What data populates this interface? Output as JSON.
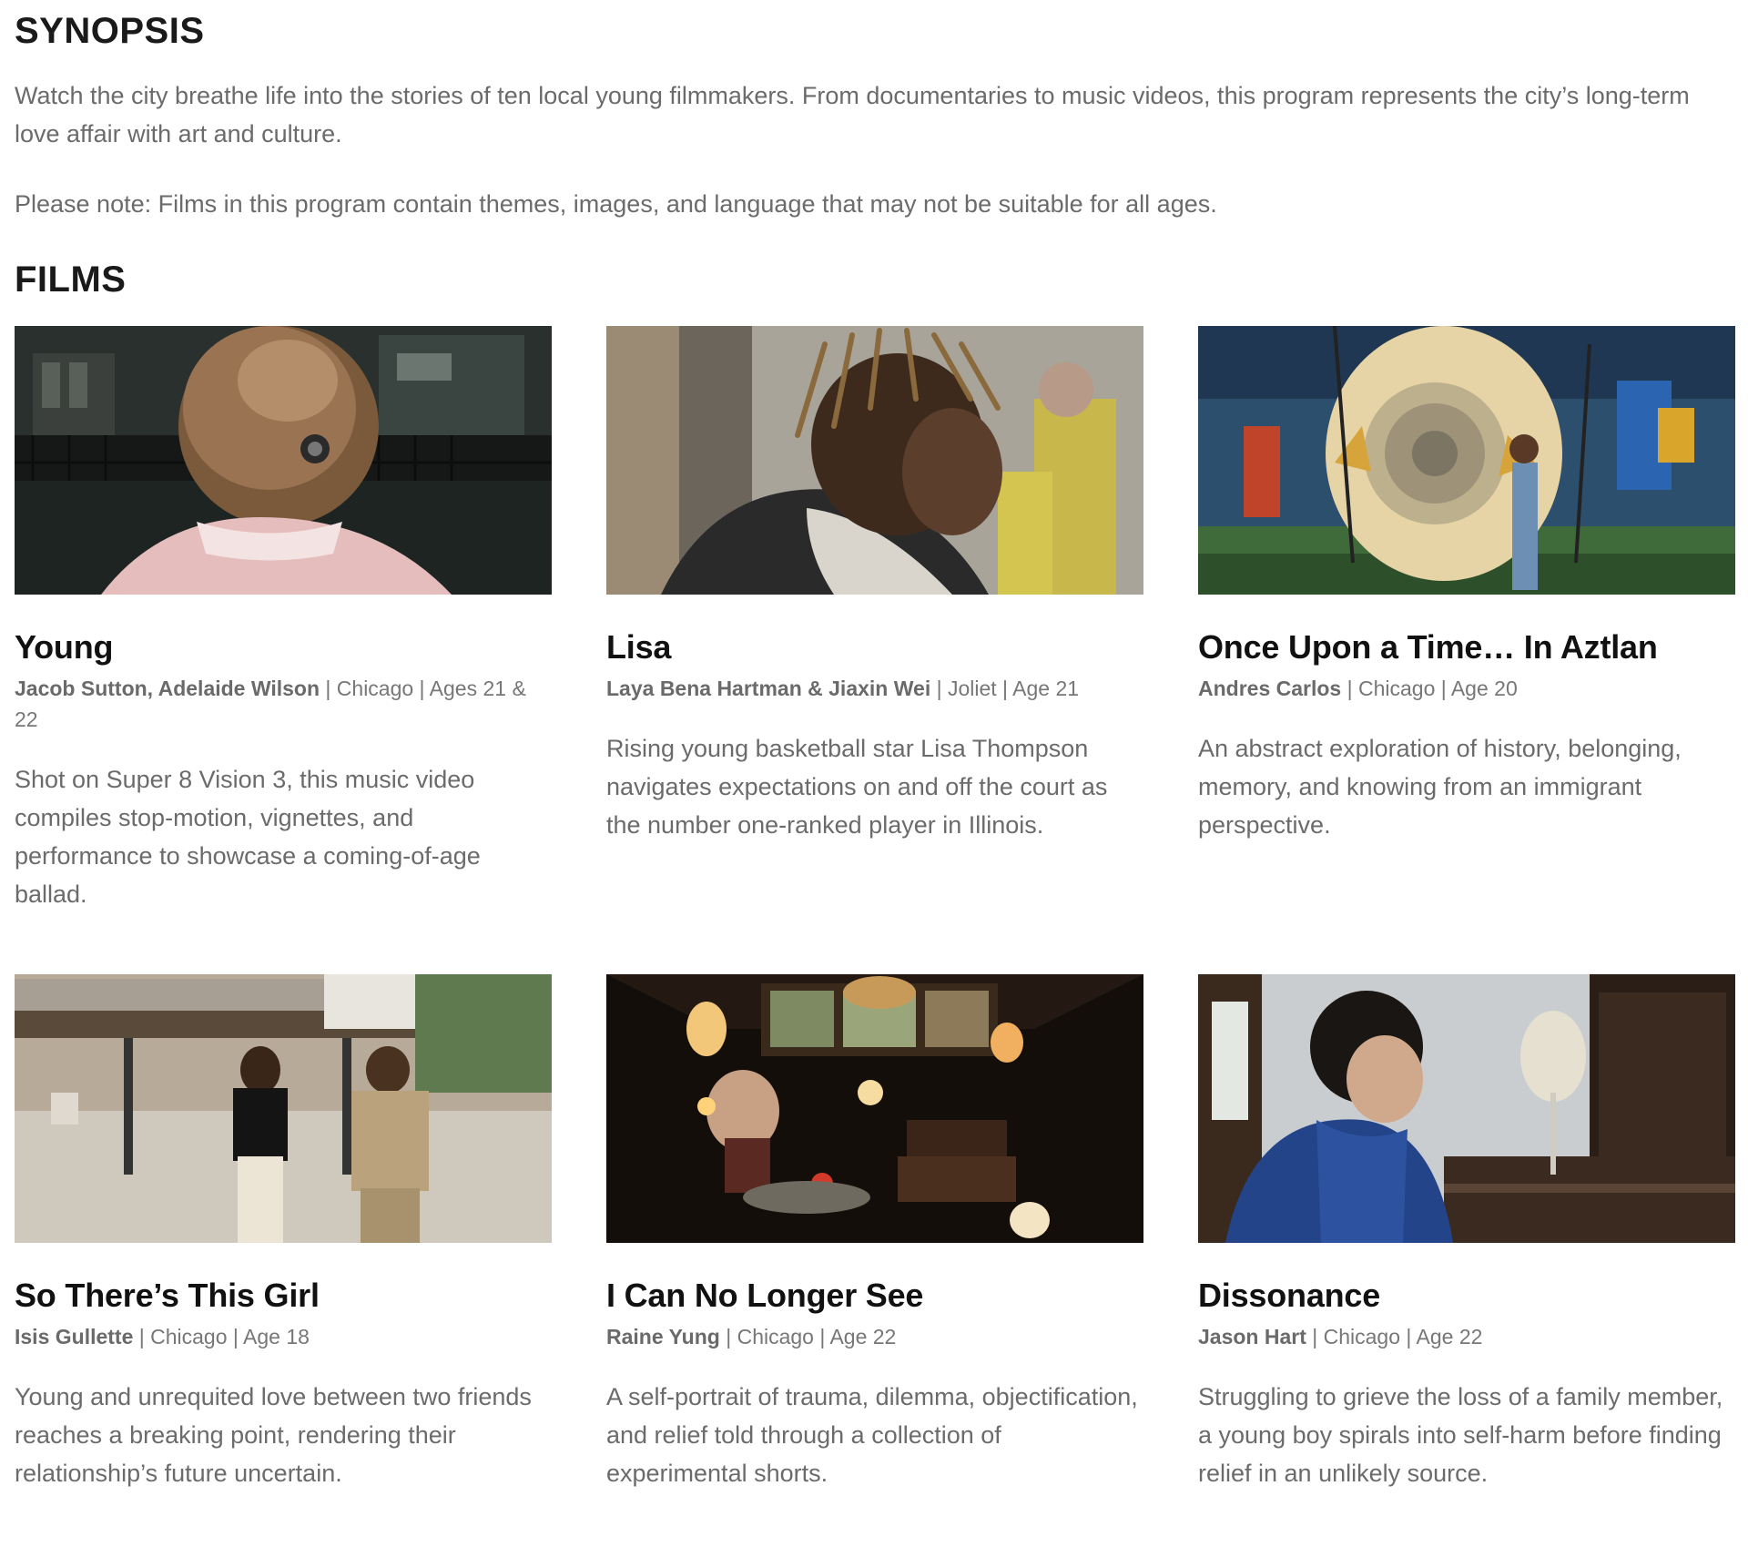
{
  "synopsis": {
    "heading": "SYNOPSIS",
    "paragraph1": "Watch the city breathe life into the stories of ten local young filmmakers. From documentaries to music videos, this program represents the city’s long-term love affair with art and culture.",
    "paragraph2": "Please note: Films in this program contain themes, images, and language that may not be suitable for all ages."
  },
  "films": {
    "heading": "FILMS",
    "items": [
      {
        "title": "Young",
        "filmmakers": "Jacob Sutton, Adelaide Wilson",
        "details": " | Chicago | Ages 21 & 22",
        "description": "Shot on Super 8 Vision 3, this music video compiles stop-motion, vignettes, and performance to showcase a coming-of-age ballad."
      },
      {
        "title": "Lisa",
        "filmmakers": "Laya Bena Hartman & Jiaxin Wei",
        "details": " | Joliet | Age 21",
        "description": "Rising young basketball star Lisa Thompson navigates expectations on and off the court as the number one-ranked player in Illinois."
      },
      {
        "title": "Once Upon a Time… In Aztlan",
        "filmmakers": "Andres Carlos",
        "details": " | Chicago | Age 20",
        "description": "An abstract exploration of history, belonging, memory, and knowing from an immigrant perspective."
      },
      {
        "title": "So There’s This Girl",
        "filmmakers": "Isis Gullette",
        "details": " | Chicago | Age 18",
        "description": "Young and unrequited love between two friends reaches a breaking point, rendering their relationship’s future uncertain."
      },
      {
        "title": "I Can No Longer See",
        "filmmakers": "Raine Yung",
        "details": " | Chicago | Age 22",
        "description": "A self-portrait of trauma, dilemma, objectification, and relief told through a collection of experimental shorts."
      },
      {
        "title": "Dissonance",
        "filmmakers": "Jason Hart",
        "details": " | Chicago | Age 22",
        "description": "Struggling to grieve the loss of a family member, a young boy spirals into self-harm before finding relief in an unlikely source."
      }
    ]
  }
}
